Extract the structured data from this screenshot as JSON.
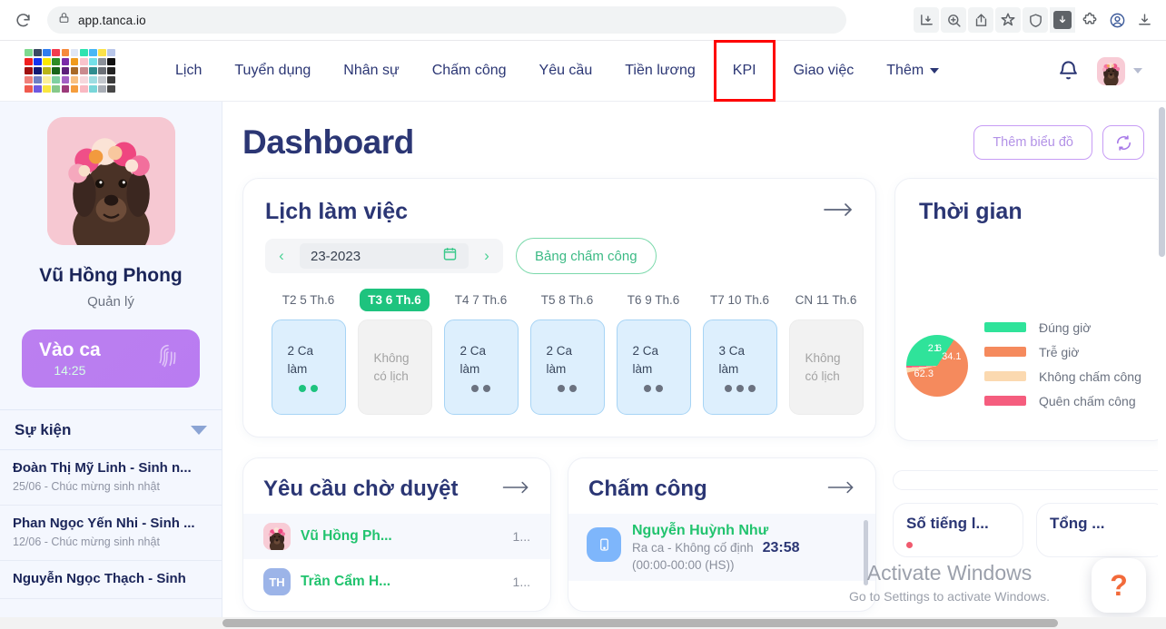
{
  "browser": {
    "url": "app.tanca.io",
    "reload_icon": "reload-icon",
    "lock_icon": "lock-icon",
    "toolbar_icons": [
      "install-app-icon",
      "zoom-icon",
      "share-icon",
      "bookmark-star-icon",
      "shield-icon",
      "download-arrow-icon",
      "extensions-puzzle-icon",
      "profile-icon",
      "downloads-tray-icon"
    ]
  },
  "nav": {
    "items": [
      {
        "label": "Lịch",
        "highlighted": false
      },
      {
        "label": "Tuyển dụng",
        "highlighted": false
      },
      {
        "label": "Nhân sự",
        "highlighted": false
      },
      {
        "label": "Chấm công",
        "highlighted": false
      },
      {
        "label": "Yêu cầu",
        "highlighted": false
      },
      {
        "label": "Tiền lương",
        "highlighted": false
      },
      {
        "label": "KPI",
        "highlighted": true
      },
      {
        "label": "Giao việc",
        "highlighted": false
      }
    ],
    "more_label": "Thêm",
    "highlight_color": "#fe0000",
    "text_color": "#2b3674"
  },
  "sidebar": {
    "profile": {
      "name": "Vũ Hồng Phong",
      "role": "Quản lý",
      "avatar_alt": "dog-avatar"
    },
    "shift_button": {
      "label": "Vào ca",
      "time": "14:25",
      "color": "#bd80f0",
      "icon": "fingerprint-icon"
    },
    "events": {
      "title": "Sự kiện",
      "items": [
        {
          "title": "Đoàn Thị Mỹ Linh - Sinh n...",
          "sub": "25/06 - Chúc mừng sinh nhật"
        },
        {
          "title": "Phan Ngọc Yến Nhi - Sinh ...",
          "sub": "12/06 - Chúc mừng sinh nhật"
        },
        {
          "title": "Nguyễn Ngọc Thạch - Sinh",
          "sub": ""
        }
      ]
    }
  },
  "main": {
    "page_title": "Dashboard",
    "actions": {
      "add_chart_label": "Thêm biểu đồ",
      "refresh_icon": "refresh-icon"
    },
    "schedule": {
      "title": "Lịch làm việc",
      "arrow_icon": "arrow-right-icon",
      "week_value": "23-2023",
      "calendar_icon": "calendar-icon",
      "prev_icon": "chevron-left-icon",
      "next_icon": "chevron-right-icon",
      "timesheet_button": "Bảng chấm công",
      "days": [
        {
          "label": "T2 5 Th.6",
          "active": false,
          "text": "2 Ca làm",
          "has_shift": true,
          "dots": 2,
          "dot_color": "green"
        },
        {
          "label": "T3 6 Th.6",
          "active": true,
          "text": "Không có lịch",
          "has_shift": false,
          "dots": 0,
          "dot_color": ""
        },
        {
          "label": "T4 7 Th.6",
          "active": false,
          "text": "2 Ca làm",
          "has_shift": true,
          "dots": 2,
          "dot_color": "gray"
        },
        {
          "label": "T5 8 Th.6",
          "active": false,
          "text": "2 Ca làm",
          "has_shift": true,
          "dots": 2,
          "dot_color": "gray"
        },
        {
          "label": "T6 9 Th.6",
          "active": false,
          "text": "2 Ca làm",
          "has_shift": true,
          "dots": 2,
          "dot_color": "gray"
        },
        {
          "label": "T7 10 Th.6",
          "active": false,
          "text": "3 Ca làm",
          "has_shift": true,
          "dots": 3,
          "dot_color": "gray"
        },
        {
          "label": "CN 11 Th.6",
          "active": false,
          "text": "Không có lịch",
          "has_shift": false,
          "dots": 0,
          "dot_color": ""
        }
      ]
    },
    "time_panel": {
      "title": "Thời gian"
    },
    "requests": {
      "title": "Yêu cầu chờ duyệt",
      "arrow_icon": "arrow-right-icon",
      "rows": [
        {
          "name": "Vũ Hồng Ph...",
          "time": "1...",
          "avatar_type": "photo",
          "initials": ""
        },
        {
          "name": "Trần Cẩm H...",
          "time": "1...",
          "avatar_type": "initials",
          "initials": "TH"
        }
      ]
    },
    "attendance": {
      "title": "Chấm công",
      "arrow_icon": "arrow-right-icon",
      "rows": [
        {
          "name": "Nguyễn Huỳnh Như",
          "sub": "Ra ca - Không cố định",
          "sub2": "(00:00-00:00 (HS))",
          "time": "23:58",
          "icon": "mobile-phone-icon"
        }
      ]
    },
    "stubs": {
      "left_title": "Số tiếng l...",
      "right_title": "Tổng ..."
    },
    "watermark": {
      "line1": "Activate Windows",
      "line2": "Go to Settings to activate Windows."
    },
    "help_fab": {
      "label": "?",
      "color": "#f26a3a"
    }
  },
  "chart_data": {
    "type": "pie",
    "title": "Thời gian",
    "categories": [
      "Đúng giờ",
      "Trễ giờ",
      "Không chấm công",
      "Quên chấm công"
    ],
    "values": [
      34.1,
      62.3,
      2.6,
      1.0
    ],
    "colors": [
      "#2fe39a",
      "#f58a5d",
      "#fbd9b0",
      "#f55d7e"
    ],
    "labels_shown": [
      "34.1",
      "62.3",
      "2.6",
      "1"
    ],
    "legend_position": "right",
    "grid": false
  },
  "logo_colors": [
    "#7fd98f",
    "#3a4a63",
    "#2f7ef0",
    "#f43b4e",
    "#f68a3c",
    "#dfe6f5",
    "#2fe3b0",
    "#49b7f5",
    "#fbe24b",
    "#b9c7ea",
    "#f02020",
    "#1533f0",
    "#fbe800",
    "#2e8c26",
    "#7a2aa8",
    "#ef9b1c",
    "#f9c4cc",
    "#74e0e8",
    "#8b9099",
    "#111111",
    "#a01010",
    "#121a73",
    "#b8b417",
    "#18641a",
    "#5d1f7a",
    "#a86a26",
    "#c98a8e",
    "#2e8d8f",
    "#6c7077",
    "#232323",
    "#f0807a",
    "#6f7fc4",
    "#fbf09a",
    "#7fd0a0",
    "#a35fc4",
    "#f8c080",
    "#f6d7dc",
    "#9ddde2",
    "#c3c7cd",
    "#3b3b3b",
    "#f05a4e",
    "#6f5ae0",
    "#f9e640",
    "#86c98a",
    "#9c3a7a",
    "#f59d3c",
    "#f9b9c2",
    "#79d6d9",
    "#a9aeb6",
    "#474747"
  ]
}
